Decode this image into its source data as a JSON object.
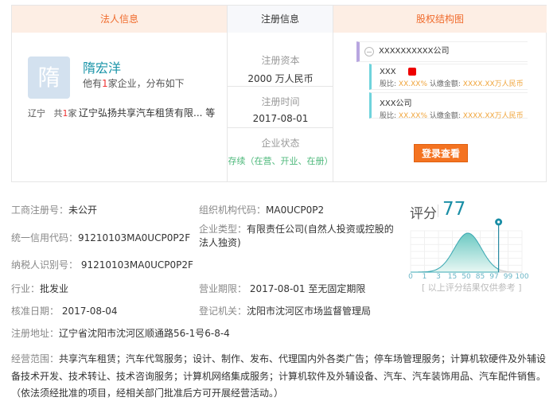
{
  "tabs": [
    "法人信息",
    "注册信息",
    "股权结构图"
  ],
  "legal": {
    "avatar_char": "隋",
    "name": "隋宏洋",
    "summary_pre": "他有",
    "summary_count": "1",
    "summary_post": "家企业，分布如下",
    "region": "辽宁",
    "total_pre": "共",
    "total_count": "1",
    "total_post": "家",
    "company": "辽宁弘扬共享汽车租赁有限... 等"
  },
  "reg": {
    "capital_label": "注册资本",
    "capital": "2000 万人民币",
    "date_label": "注册时间",
    "date": "2017-08-01",
    "status_label": "企业状态",
    "status": "存续（在营、开业、在册）"
  },
  "equity": {
    "root": "XXXXXXXXXX公司",
    "children": [
      {
        "name": "XXX",
        "ratio_label": "股比:",
        "ratio": "XX.XX%",
        "amount_label": "认缴金额:",
        "amount": "XXXX.XX万人民币"
      },
      {
        "name": "XXX公司",
        "ratio_label": "股比:",
        "ratio": "XX.XX%",
        "amount_label": "认缴金额:",
        "amount": "XXXX.XX万人民币"
      }
    ],
    "login": "登录查看"
  },
  "info": [
    {
      "k": "工商注册号：",
      "v": "未公开"
    },
    {
      "k": "组织机构代码：",
      "v": "MA0UCP0P2"
    },
    {
      "k": "统一信用代码：",
      "v": "91210103MA0UCP0P2F"
    },
    {
      "k": "企业类型：",
      "v": "有限责任公司(自然人投资或控股的法人独资)"
    },
    {
      "k": "纳税人识别号：",
      "v": " 91210103MA0UCP0P2F"
    },
    {
      "k": "行业：",
      "v": "批发业"
    },
    {
      "k": "营业期限：",
      "v": " 2017-08-01 至无固定期限"
    },
    {
      "k": "核准日期：",
      "v": " 2017-08-04"
    },
    {
      "k": "登记机关：",
      "v": "沈阳市沈河区市场监督管理局"
    },
    {
      "k": "注册地址：",
      "v": "辽宁省沈阳市沈河区顺通路56-1号6-8-4"
    }
  ],
  "score": {
    "label": "评分",
    "value": "77",
    "percentile": 77,
    "ticks": [
      "0",
      "1",
      "3",
      "15",
      "50",
      "85",
      "97",
      "99",
      "100"
    ],
    "note": "[ 以上评分结果仅供参考 ]",
    "accent": "#1a8ea6"
  },
  "scope": {
    "label": "经营范围：",
    "text": "共享汽车租赁；汽车代驾服务；设计、制作、发布、代理国内外各类广告；停车场管理服务；计算机软硬件及外辅设备技术开发、技术转让、技术咨询服务；计算机网络集成服务；计算机软件及外辅设备、汽车、汽车装饰用品、汽车配件销售。（依法须经批准的项目，经相关部门批准后方可开展经营活动。）"
  }
}
